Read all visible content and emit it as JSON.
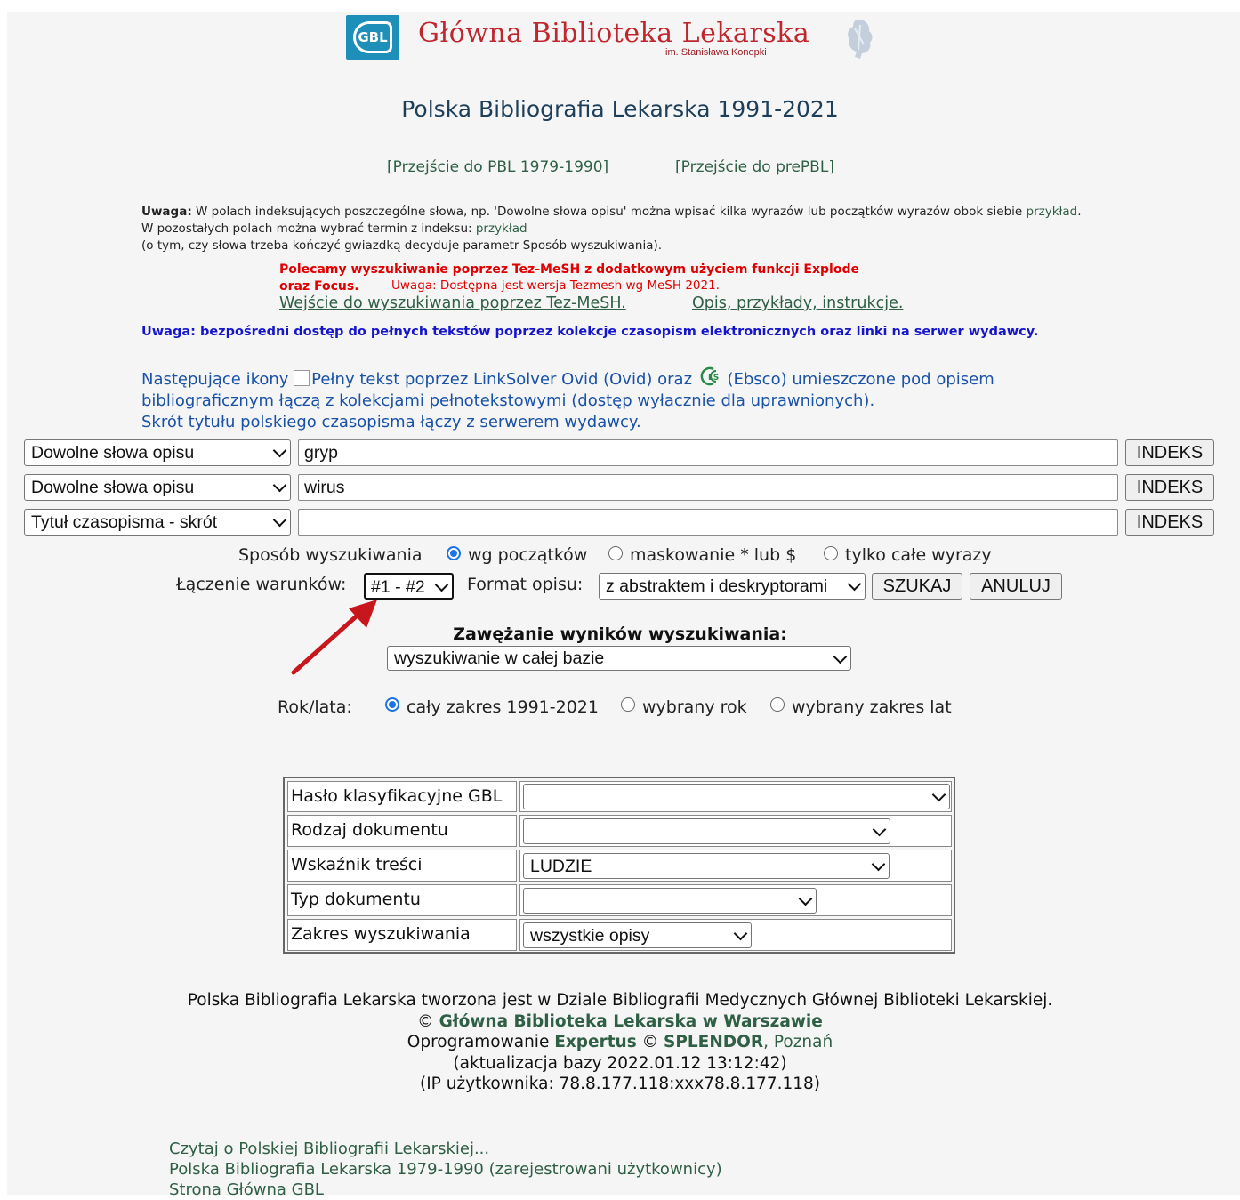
{
  "header": {
    "logo_text": "GBL",
    "library_name": "Główna Biblioteka Lekarska",
    "library_subtitle": "im. Stanisława Konopki"
  },
  "page_title": "Polska Bibliografia Lekarska 1991-2021",
  "top_links": {
    "pbl_1979": "[Przejście do PBL 1979-1990]",
    "prepbl": "[Przejście do prePBL]"
  },
  "note": {
    "bold": "Uwaga:",
    "text1": " W polach indeksujących poszczególne słowa, np. 'Dowolne słowa opisu' można wpisać kilka wyrazów lub początków wyrazów obok siebie ",
    "link1": "przykład",
    "text2": ". W pozostałych polach można wybrać termin z indeksu: ",
    "link2": "przykład",
    "text3": "(o tym, czy słowa trzeba kończyć gwiazdką decyduje parametr Sposób wyszukiwania)."
  },
  "tezmesh": {
    "recommend_line1": "Polecamy wyszukiwanie poprzez Tez-MeSH z dodatkowym użyciem funkcji Explode",
    "recommend_line2": "oraz Focus.",
    "version_note": "Uwaga: Dostępna jest wersja Tezmesh wg MeSH 2021.",
    "enter_link": "Wejście do wyszukiwania poprzez Tez-MeSH.",
    "help_link": "Opis, przykłady, instrukcje."
  },
  "fulltext_note": "Uwaga: bezpośredni dostęp do pełnych tekstów poprzez kolekcje czasopism elektronicznych oraz linki na serwer wydawcy.",
  "icons_note": {
    "part1": "Następujące ikony ",
    "img_alt": "Pełny tekst poprzez LinkSolver Ovid (Ovid)",
    "part2": " oraz ",
    "part3": " (Ebsco) umieszczone pod opisem bibliograficznym łączą z kolekcjami pełnotekstowymi (dostęp wyłacznie dla uprawnionych).",
    "line3": "Skrót tytułu polskiego czasopisma łączy z serwerem wydawcy."
  },
  "search_rows": [
    {
      "field": "Dowolne słowa opisu",
      "value": "gryp",
      "button": "INDEKS"
    },
    {
      "field": "Dowolne słowa opisu",
      "value": "wirus",
      "button": "INDEKS"
    },
    {
      "field": "Tytuł czasopisma - skrót",
      "value": "",
      "button": "INDEKS"
    }
  ],
  "search_mode": {
    "label": "Sposób wyszukiwania",
    "options": [
      "wg początków",
      "maskowanie * lub $",
      "tylko całe wyrazy"
    ],
    "selected": "wg początków"
  },
  "conditions": {
    "label": "Łączenie warunków:",
    "value": "#1 - #2",
    "format_label": "Format opisu:",
    "format_value": "z abstraktem i deskryptorami",
    "search_button": "SZUKAJ",
    "cancel_button": "ANULUJ"
  },
  "narrowing": {
    "title": "Zawężanie wyników wyszukiwania:",
    "value": "wyszukiwanie w całej bazie"
  },
  "years": {
    "label": "Rok/lata:",
    "options": [
      "cały zakres 1991-2021",
      "wybrany rok",
      "wybrany zakres lat"
    ],
    "selected": "cały zakres 1991-2021"
  },
  "filters": [
    {
      "label": "Hasło klasyfikacyjne GBL",
      "value": ""
    },
    {
      "label": "Rodzaj dokumentu",
      "value": ""
    },
    {
      "label": "Wskaźnik treści",
      "value": "LUDZIE"
    },
    {
      "label": "Typ dokumentu",
      "value": ""
    },
    {
      "label": "Zakres wyszukiwania",
      "value": "wszystkie opisy"
    }
  ],
  "footer": {
    "line1": "Polska Bibliografia Lekarska tworzona jest w Dziale Bibliografii Medycznych Głównej Biblioteki Lekarskiej.",
    "copyright": "©",
    "gbl_link": "Główna Biblioteka Lekarska w Warszawie",
    "software": "Oprogramowanie",
    "expertus": "Expertus",
    "splendor": "SPLENDOR",
    "poznan": ", Poznań",
    "update": "(aktualizacja bazy 2022.01.12 13:12:42)",
    "ip": "(IP użytkownika: 78.8.177.118:xxx78.8.177.118)"
  },
  "bottom_links": [
    "Czytaj o Polskiej Bibliografii Lekarskiej...",
    "Polska Bibliografia Lekarska 1979-1990 (zarejestrowani użytkownicy)",
    "Strona Główna GBL"
  ],
  "colors": {
    "accent_red": "#c0262d",
    "link_green": "#2f5f45",
    "note_blue": "#1515cc",
    "radio_blue": "#1a73e8",
    "arrow": "#c8161d"
  }
}
